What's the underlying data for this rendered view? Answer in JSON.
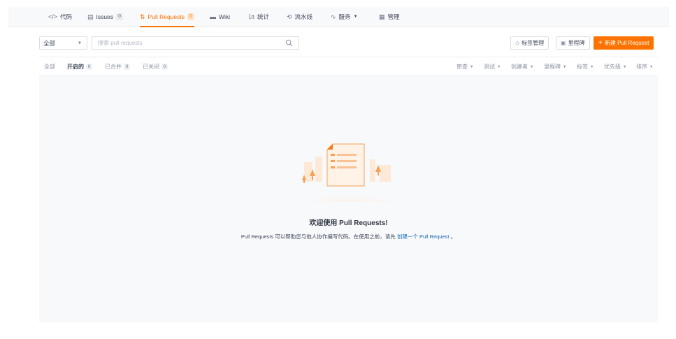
{
  "nav": {
    "items": [
      {
        "icon": "</>",
        "label": "代码",
        "badge": null
      },
      {
        "icon": "▤",
        "label": "Issues",
        "badge": "0"
      },
      {
        "icon": "⇅",
        "label": "Pull Requests",
        "badge": "0"
      },
      {
        "icon": "▬",
        "label": "Wiki",
        "badge": null
      },
      {
        "icon": "㏑",
        "label": "统计",
        "badge": null
      },
      {
        "icon": "⟲",
        "label": "流水线",
        "badge": null
      },
      {
        "icon": "∿",
        "label": "服务",
        "badge": null
      },
      {
        "icon": "▦",
        "label": "管理",
        "badge": null
      }
    ],
    "service_caret": "▼",
    "active": "Pull Requests",
    "accent_color": "#fe7300"
  },
  "toolbar": {
    "scope_select": "全部",
    "search_placeholder": "搜索 pull requests",
    "label_manage": "标签管理",
    "milestone": "里程碑",
    "new_pr_plus": "+",
    "new_pr": "新建 Pull Request"
  },
  "state_tabs": [
    {
      "label": "全部",
      "badge": null
    },
    {
      "label": "开启的",
      "badge": "0"
    },
    {
      "label": "已合并",
      "badge": "0"
    },
    {
      "label": "已关闭",
      "badge": "0"
    }
  ],
  "filters": [
    "审查",
    "测试",
    "创建者",
    "里程碑",
    "标签",
    "优先级",
    "排序"
  ],
  "empty": {
    "title": "欢迎使用 Pull Requests!",
    "desc_before": "Pull Requests 可以帮助您与他人协作编写代码。在使用之前，请先",
    "desc_link": "创建一个 Pull Request",
    "desc_after": "。"
  }
}
